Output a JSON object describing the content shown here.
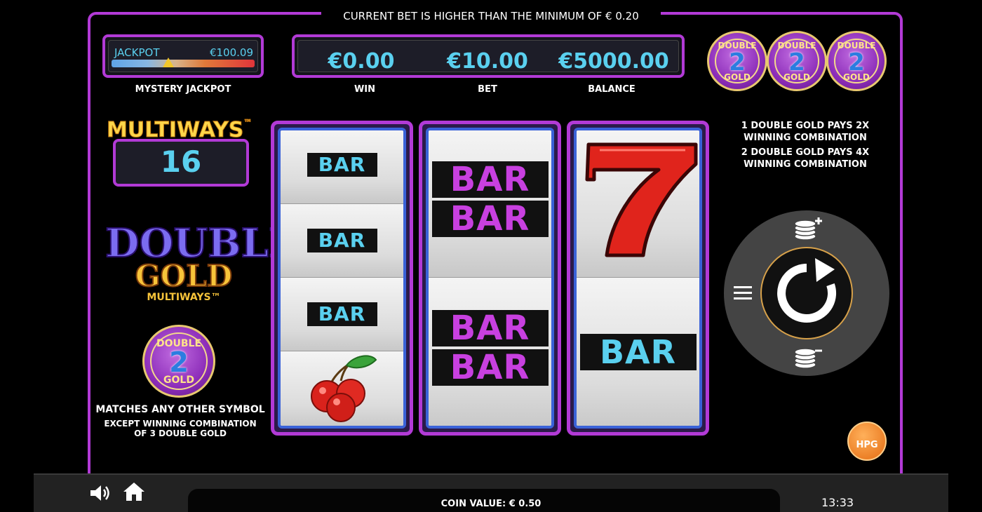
{
  "top_message": "CURRENT BET IS HIGHER THAN THE MINIMUM OF € 0.20",
  "jackpot": {
    "label": "JACKPOT",
    "value": "€100.09",
    "caption": "MYSTERY JACKPOT",
    "level_fraction": 0.38
  },
  "money": {
    "win_value": "€0.00",
    "win_label": "WIN",
    "bet_value": "€10.00",
    "bet_label": "BET",
    "balance_value": "€5000.00",
    "balance_label": "BALANCE"
  },
  "coin_symbol": {
    "top": "DOUBLE",
    "number": "2",
    "bottom": "GOLD"
  },
  "pays": {
    "line1a": "1 DOUBLE GOLD PAYS 2X",
    "line1b": "WINNING COMBINATION",
    "line2a": "2 DOUBLE GOLD PAYS 4X",
    "line2b": "WINNING COMBINATION"
  },
  "multiways": {
    "title": "MULTIWAYS",
    "tm": "™",
    "count": "16"
  },
  "logo": {
    "double": "DOUBLE",
    "gold": "GOLD",
    "multiways": "MULTIWAYS™"
  },
  "wild_info": {
    "line1": "MATCHES ANY OTHER SYMBOL",
    "line2": "EXCEPT WINNING COMBINATION",
    "line3": "OF 3 DOUBLE GOLD"
  },
  "reels": {
    "reel1": [
      "BAR",
      "BAR",
      "BAR",
      "cherry"
    ],
    "reel2": [
      "BAR",
      "BAR",
      "BAR",
      "BAR"
    ],
    "reel3": [
      "7",
      "BAR"
    ]
  },
  "bar_text": "BAR",
  "seven_text": "7",
  "hpg_text": "HPG",
  "coin_value": "COIN VALUE: € 0.50",
  "clock": "13:33",
  "colors": {
    "frame": "#b23ad6",
    "accent_blue": "#5ad0ef",
    "bar_purple": "#c840e0",
    "seven_red": "#e0241c",
    "gold": "#ffd74a"
  },
  "icons": {
    "sound": "speaker-icon",
    "home": "home-icon",
    "menu": "hamburger-menu-icon",
    "spin": "spin-arrow-icon",
    "bet_plus": "coins-plus-icon",
    "bet_minus": "coins-minus-icon"
  }
}
